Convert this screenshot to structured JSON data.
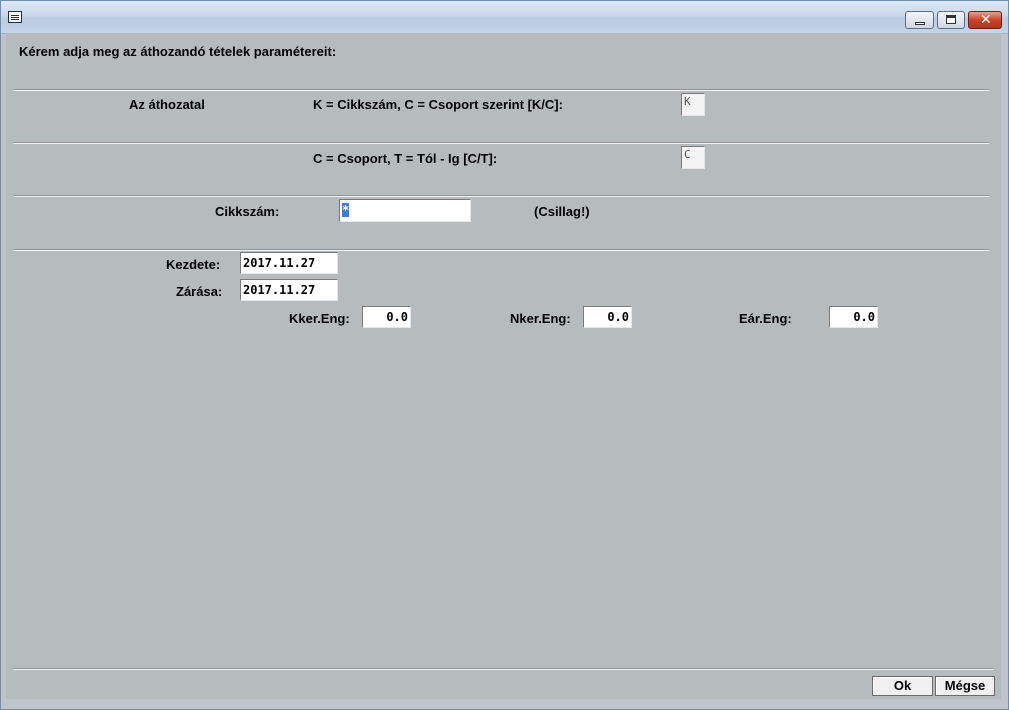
{
  "form": {
    "heading": "Kérem adja meg az áthozandó  tételek paramétereit:",
    "section1_label": "Az áthozatal",
    "mode_label": "K = Cikkszám,   C = Csoport szerint [K/C]:",
    "mode_value": "K",
    "range_label": "C = Csoport,    T = Tól - Ig [C/T]:",
    "range_value": "C",
    "article_label": "Cikkszám:",
    "article_value": "*",
    "article_hint": "(Csillag!)",
    "start_label": "Kezdete:",
    "start_value": "2017.11.27",
    "end_label": "Zárása:",
    "end_value": "2017.11.27",
    "kker_label": "Kker.Eng:",
    "kker_value": "0.0",
    "nker_label": "Nker.Eng:",
    "nker_value": "0.0",
    "ear_label": "Eár.Eng:",
    "ear_value": "0.0"
  },
  "buttons": {
    "ok": "Ok",
    "cancel": "Mégse"
  },
  "icons": {
    "system_menu": "window-menu-icon",
    "minimize": "minimize-icon",
    "maximize": "maximize-icon",
    "close": "close-icon"
  }
}
